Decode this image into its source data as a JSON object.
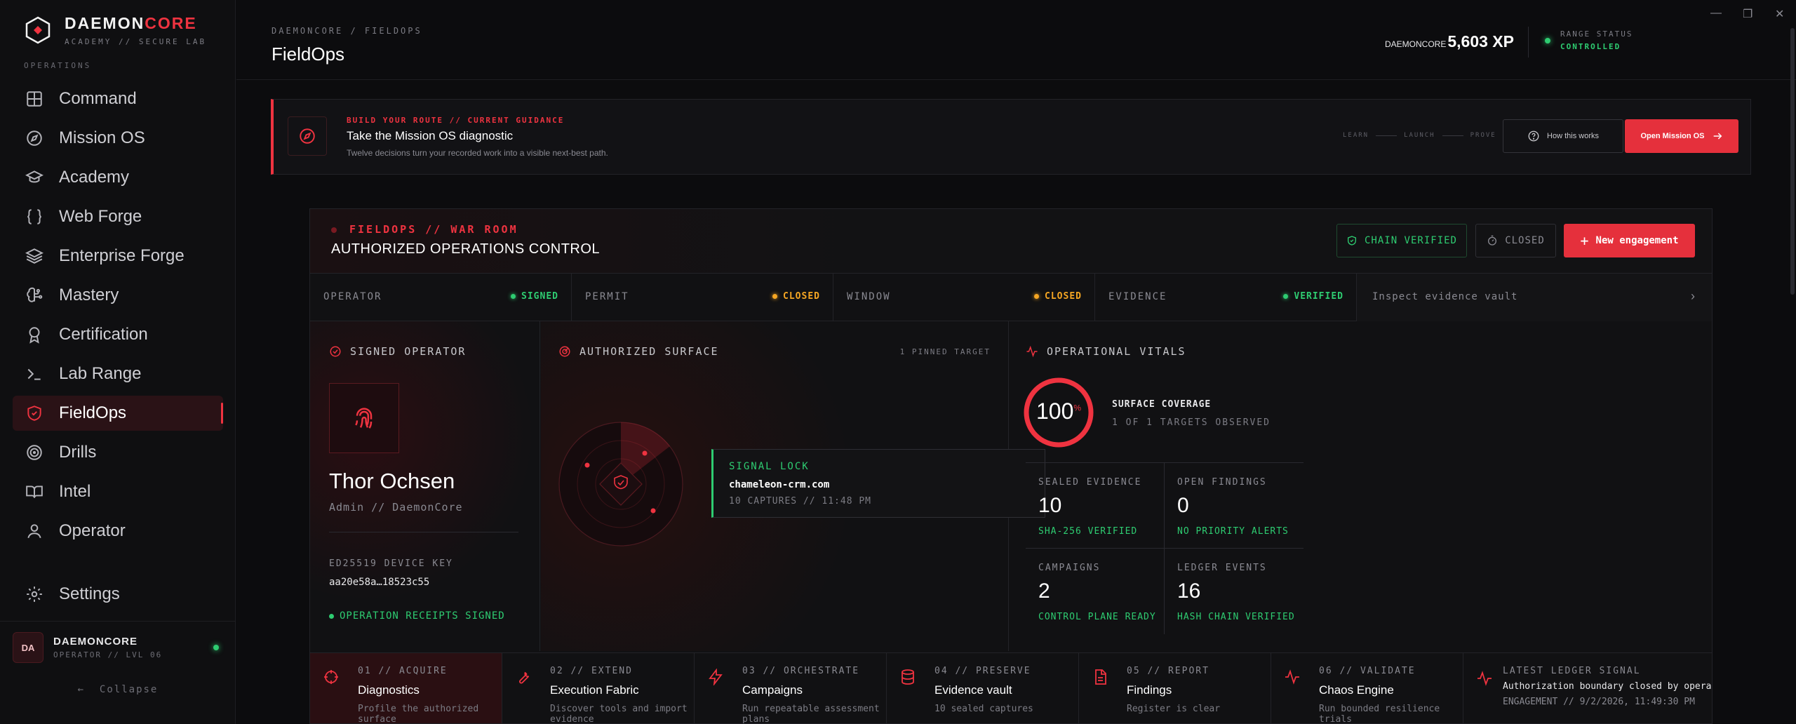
{
  "brand": {
    "name_main": "DAEMON",
    "name_accent": "CORE",
    "subtitle": "ACADEMY // SECURE LAB",
    "section_label": "OPERATIONS"
  },
  "sidebar": {
    "items": [
      {
        "label": "Command",
        "icon": "grid-icon"
      },
      {
        "label": "Mission OS",
        "icon": "compass-icon"
      },
      {
        "label": "Academy",
        "icon": "graduation-cap-icon"
      },
      {
        "label": "Web Forge",
        "icon": "braces-icon"
      },
      {
        "label": "Enterprise Forge",
        "icon": "layers-icon"
      },
      {
        "label": "Mastery",
        "icon": "brain-icon"
      },
      {
        "label": "Certification",
        "icon": "award-icon"
      },
      {
        "label": "Lab Range",
        "icon": "terminal-icon"
      },
      {
        "label": "FieldOps",
        "icon": "shield-icon"
      },
      {
        "label": "Drills",
        "icon": "target-icon"
      },
      {
        "label": "Intel",
        "icon": "book-icon"
      },
      {
        "label": "Operator",
        "icon": "user-icon"
      }
    ],
    "active": "FieldOps",
    "settings_label": "Settings",
    "user": {
      "initials": "DA",
      "name": "DAEMONCORE",
      "role": "OPERATOR // LVL 06"
    },
    "collapse_label": "Collapse"
  },
  "header": {
    "breadcrumb": "DAEMONCORE / FIELDOPS",
    "title": "FieldOps",
    "xp_brand": "DAEMONCORE",
    "xp_value": "5,603 XP",
    "range_label": "RANGE STATUS",
    "range_value": "CONTROLLED"
  },
  "window_controls": {
    "minimize": "—",
    "maximize": "❐",
    "close": "✕"
  },
  "banner": {
    "kicker": "BUILD YOUR ROUTE // CURRENT GUIDANCE",
    "title": "Take the Mission OS diagnostic",
    "subtitle": "Twelve decisions turn your recorded work into a visible next-best path.",
    "steps": [
      "LEARN",
      "LAUNCH",
      "PROVE"
    ],
    "how_label": "How this works",
    "open_label": "Open Mission OS"
  },
  "warroom": {
    "kicker": "FIELDOPS // WAR ROOM",
    "title": "AUTHORIZED OPERATIONS CONTROL",
    "chain_label": "CHAIN VERIFIED",
    "closed_label": "CLOSED",
    "new_label": "New engagement",
    "status": [
      {
        "label": "OPERATOR",
        "value": "SIGNED",
        "tone": "green"
      },
      {
        "label": "PERMIT",
        "value": "CLOSED",
        "tone": "amber"
      },
      {
        "label": "WINDOW",
        "value": "CLOSED",
        "tone": "amber"
      },
      {
        "label": "EVIDENCE",
        "value": "VERIFIED",
        "tone": "green"
      }
    ],
    "inspect_label": "Inspect evidence vault"
  },
  "operator": {
    "heading": "SIGNED OPERATOR",
    "name": "Thor Ochsen",
    "role": "Admin // DaemonCore",
    "key_label": "ED25519 DEVICE KEY",
    "key_value": "aa20e58a…18523c55",
    "receipts": "OPERATION RECEIPTS SIGNED"
  },
  "surface": {
    "heading": "AUTHORIZED SURFACE",
    "pinned": "1 PINNED TARGET",
    "lock_label": "SIGNAL LOCK",
    "lock_host": "chameleon-crm.com",
    "lock_meta": "10 CAPTURES // 11:48 PM"
  },
  "vitals": {
    "heading": "OPERATIONAL VITALS",
    "coverage_value": "100",
    "coverage_unit": "%",
    "coverage_fraction": 1.0,
    "coverage_title": "SURFACE COVERAGE",
    "coverage_sub": "1 OF 1 TARGETS OBSERVED",
    "cells": [
      {
        "label": "SEALED EVIDENCE",
        "value": "10",
        "sub": "SHA-256 VERIFIED"
      },
      {
        "label": "OPEN FINDINGS",
        "value": "0",
        "sub": "NO PRIORITY ALERTS"
      },
      {
        "label": "CAMPAIGNS",
        "value": "2",
        "sub": "CONTROL PLANE READY"
      },
      {
        "label": "LEDGER EVENTS",
        "value": "16",
        "sub": "HASH CHAIN VERIFIED"
      }
    ]
  },
  "pipeline": [
    {
      "kicker": "01 // ACQUIRE",
      "title": "Diagnostics",
      "desc": "Profile the authorized surface"
    },
    {
      "kicker": "02 // EXTEND",
      "title": "Execution Fabric",
      "desc": "Discover tools and import evidence"
    },
    {
      "kicker": "03 // ORCHESTRATE",
      "title": "Campaigns",
      "desc": "Run repeatable assessment plans"
    },
    {
      "kicker": "04 // PRESERVE",
      "title": "Evidence vault",
      "desc": "10 sealed captures"
    },
    {
      "kicker": "05 // REPORT",
      "title": "Findings",
      "desc": "Register is clear"
    },
    {
      "kicker": "06 // VALIDATE",
      "title": "Chaos Engine",
      "desc": "Run bounded resilience trials"
    }
  ],
  "ledger": {
    "kicker": "LATEST LEDGER SIGNAL",
    "text": "Authorization boundary closed by operator",
    "meta": "ENGAGEMENT // 9/2/2026, 11:49:30 PM"
  },
  "colors": {
    "accent": "#ef3340",
    "ok": "#2ecc71",
    "warn": "#f5a623",
    "bg": "#0c0c0e"
  }
}
